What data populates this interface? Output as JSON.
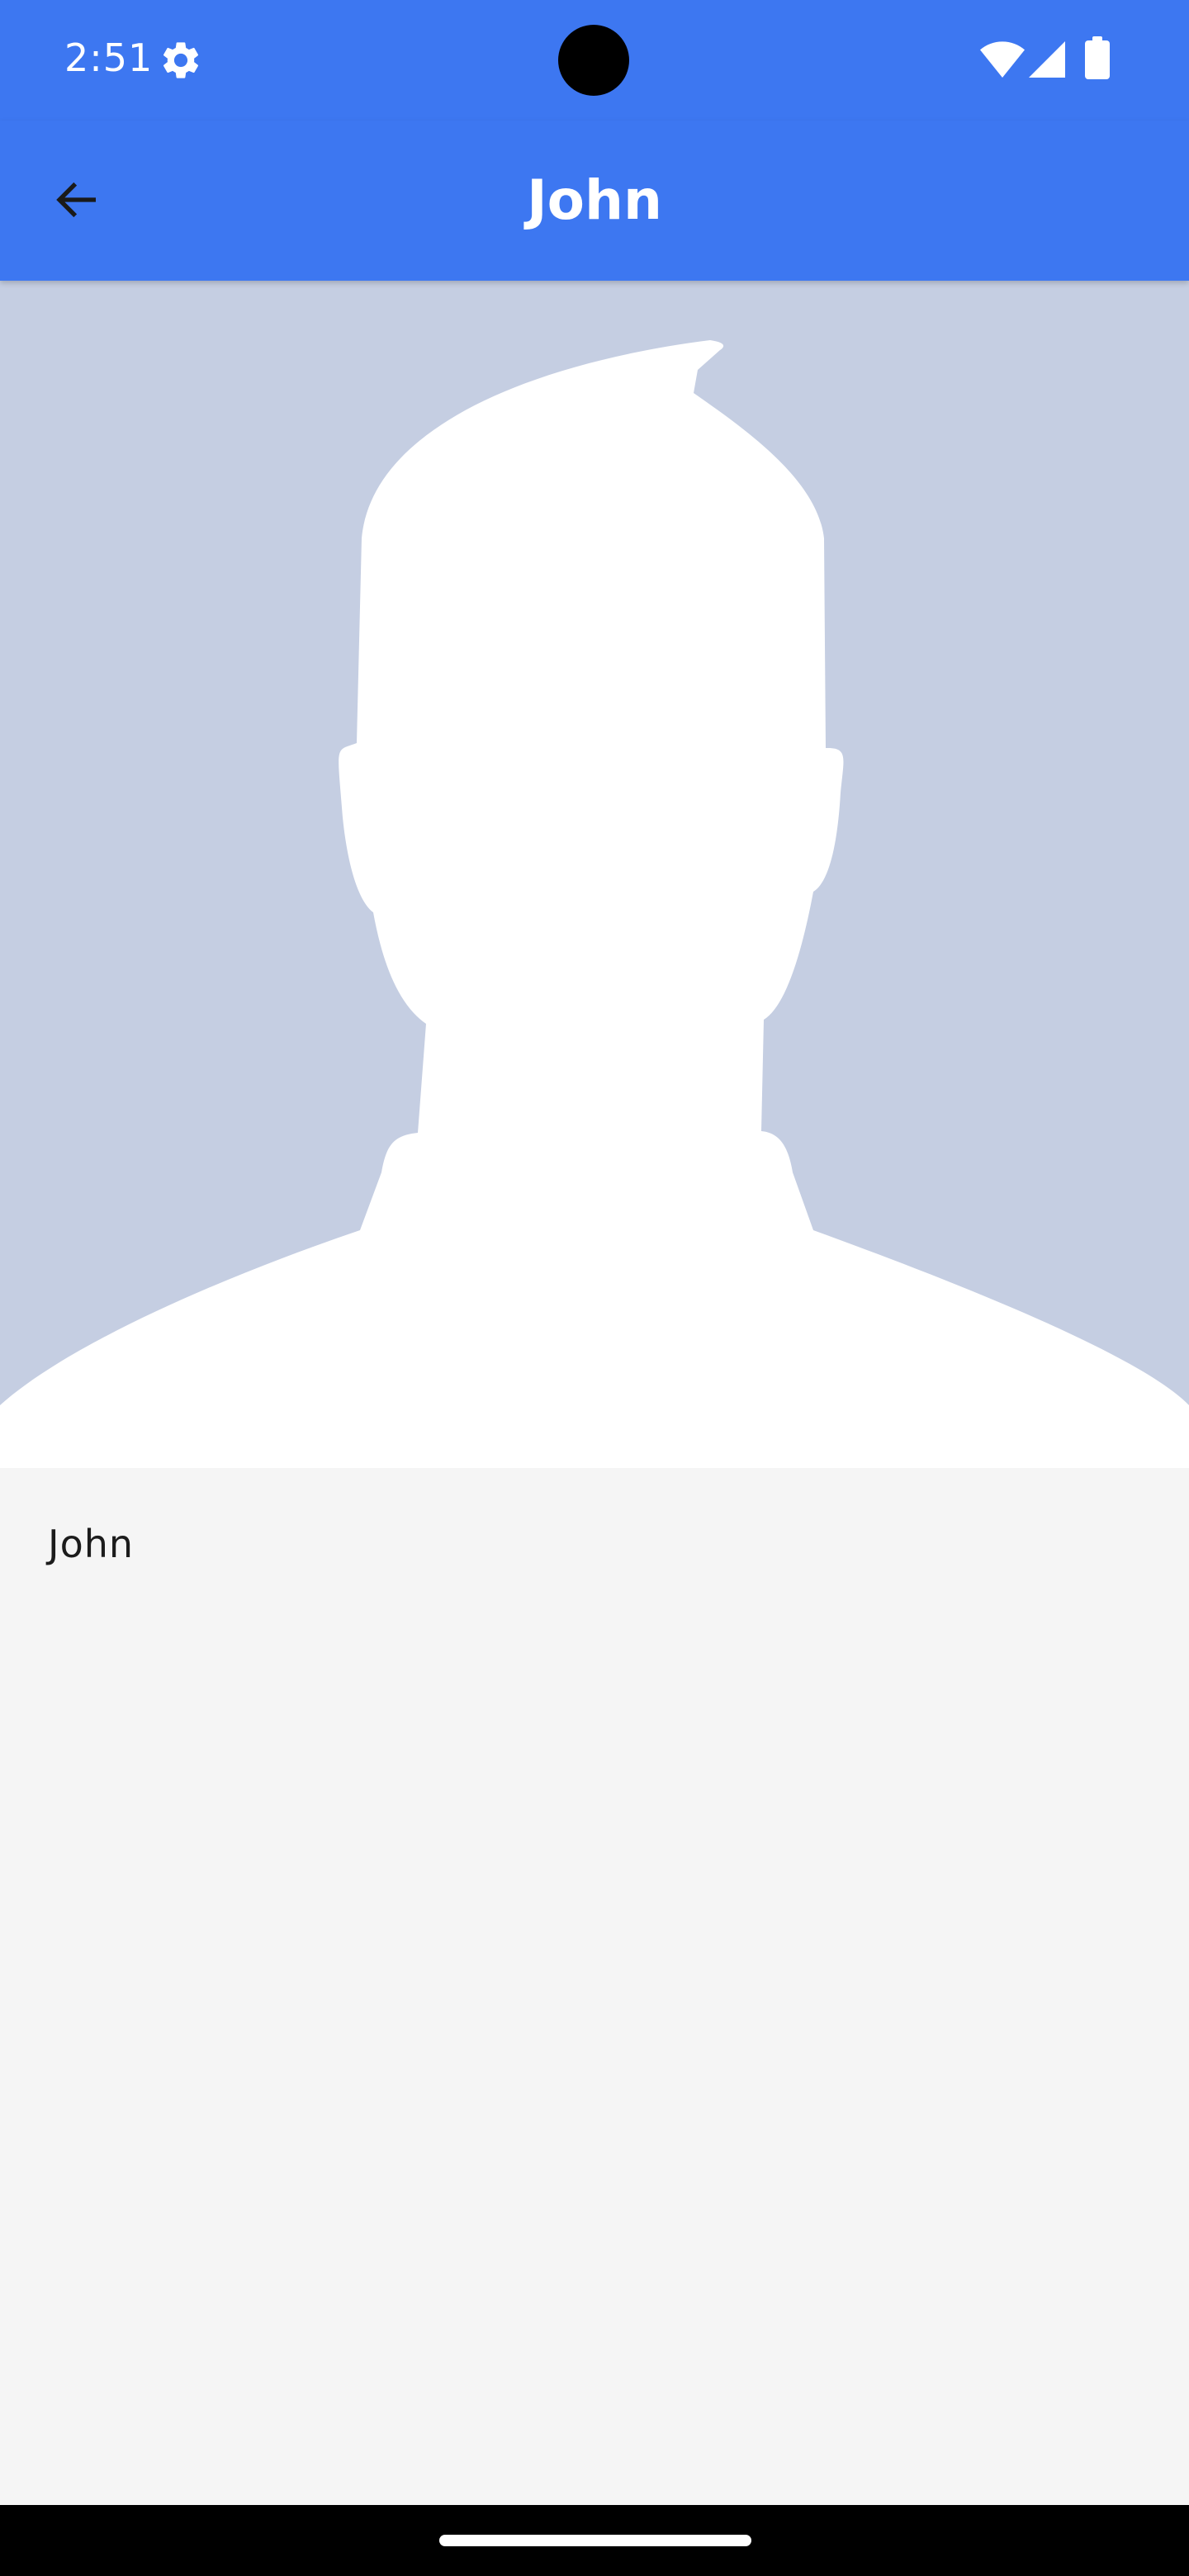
{
  "status_bar": {
    "time": "2:51",
    "settings_icon": "gear-icon",
    "wifi_icon": "wifi-icon",
    "signal_icon": "cell-signal-icon",
    "battery_icon": "battery-icon"
  },
  "app_bar": {
    "title": "John",
    "back_icon": "arrow-back-icon",
    "color": "#3d77f1"
  },
  "profile": {
    "image": "person-silhouette-placeholder",
    "image_bg_color": "#c5cee2",
    "name": "John"
  },
  "nav_bar": {
    "home_handle": "home-gesture-handle"
  }
}
